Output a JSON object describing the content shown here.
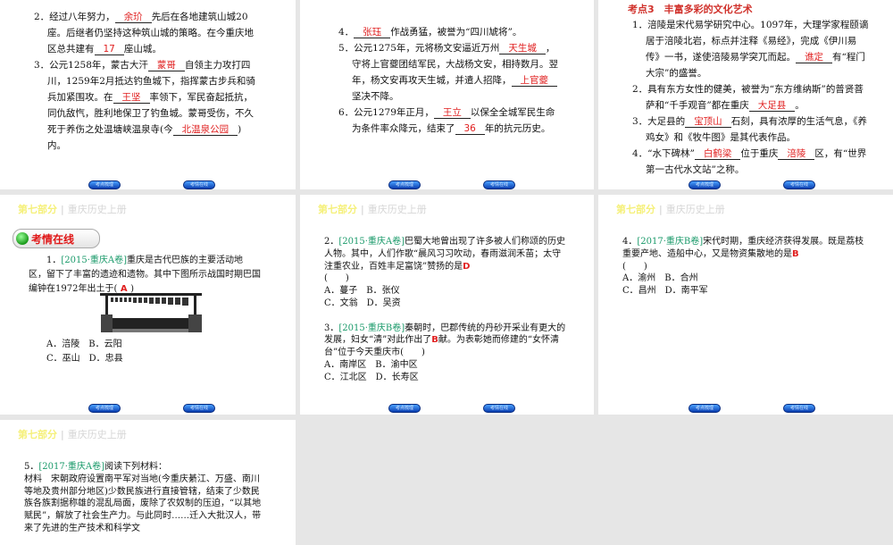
{
  "header": {
    "part": "第七部分",
    "sep": "|",
    "book": "重庆历史上册"
  },
  "nav": {
    "review": "考点梳理",
    "online": "考情在线"
  },
  "section_title": "考情在线",
  "topic3": "考点3　丰富多彩的文化艺术",
  "slides": {
    "s1": [
      [
        {
          "t": "2．经过八年努力，"
        },
        {
          "f": "余玠"
        },
        {
          "t": "先后在各地建筑山城20座。后继者仍坚持这种筑山城的策略。在今重庆地区总共建有"
        },
        {
          "f": "17"
        },
        {
          "t": "座山城。"
        }
      ],
      [
        {
          "t": "3．公元1258年，蒙古大汗"
        },
        {
          "f": "蒙哥"
        },
        {
          "t": "自领主力攻打四川，1259年2月抵达钓鱼城下，指挥蒙古步兵和骑兵加紧围攻。在"
        },
        {
          "f": "王坚"
        },
        {
          "t": "率领下，军民奋起抵抗，同仇敌忾，胜利地保卫了钓鱼城。蒙哥受伤，不久死于养伤之处温塘峡温泉寺(今"
        },
        {
          "f": "北温泉公园"
        },
        {
          "t": ")内。"
        }
      ]
    ],
    "s2": [
      [
        {
          "t": "4．"
        },
        {
          "f": "张珏"
        },
        {
          "t": "作战勇猛，被誉为“四川虓将”。"
        }
      ],
      [
        {
          "t": "5．公元1275年，元将杨文安逼近万州"
        },
        {
          "f": "天生城"
        },
        {
          "t": "，守将上官夔团结军民，大战杨文安，相持数月。翌年，杨文安再攻天生城，并遣人招降，"
        },
        {
          "f": "上官夔"
        },
        {
          "t": "坚决不降。"
        }
      ],
      [
        {
          "t": "6．公元1279年正月，"
        },
        {
          "f": "王立"
        },
        {
          "t": "以保全全城军民生命为条件率众降元，结束了"
        },
        {
          "f": "36"
        },
        {
          "t": "年的抗元历史。"
        }
      ]
    ],
    "s3": [
      [
        {
          "t": "1．涪陵是宋代易学研究中心。1097年，大理学家程颐谪居于涪陵北岩，标点并注释《易经》，完成《伊川易传》一书，遂使涪陵易学突兀而起。"
        },
        {
          "f": "谯定"
        },
        {
          "t": "有“程门大宗”的盛誉。"
        }
      ],
      [
        {
          "t": "2．具有东方女性的健美，被誉为“东方维纳斯”的普贤菩萨和“千手观音”都在重庆"
        },
        {
          "f": "大足县"
        },
        {
          "t": "。"
        }
      ],
      [
        {
          "t": "3．大足县的"
        },
        {
          "f": "宝顶山"
        },
        {
          "t": "石刻，具有浓厚的生活气息，《养鸡女》和《牧牛图》是其代表作品。"
        }
      ],
      [
        {
          "t": "4．“水下碑林”"
        },
        {
          "f": "白鹤梁"
        },
        {
          "t": "位于重庆"
        },
        {
          "f": "涪陵"
        },
        {
          "t": "区，有“世界第一古代水文站”之称。"
        }
      ]
    ],
    "s4": [
      [
        {
          "t": "　　1．"
        },
        {
          "s": "[2015·重庆A卷]"
        },
        {
          "t": "重庆是古代巴族的主要活动地区，留下了丰富的遗迹和遗物。其中下图所示战国时期巴国编钟在1972年出土于("
        },
        {
          "a": " A "
        },
        {
          "t": ")"
        }
      ]
    ],
    "s4opts": [
      [
        {
          "t": "　　A．涪陵　B．云阳"
        }
      ],
      [
        {
          "t": "　　C．巫山　D．忠县"
        }
      ]
    ],
    "s5": [
      [
        {
          "t": "2．"
        },
        {
          "s": "[2015·重庆A卷]"
        },
        {
          "t": "巴蜀大地曾出现了许多被人们称颂的历史人物。其中，人们作歌“晨风习习吹动，春雨滋润禾苗；太守注重农业，百姓丰足富饶”赞扬的是"
        },
        {
          "a": "D"
        }
      ],
      [
        {
          "t": "(　　)"
        }
      ],
      [
        {
          "t": "A．蔓子　B．张仪"
        }
      ],
      [
        {
          "t": "C．文翁　D．吴资"
        }
      ],
      [
        {
          "t": "　"
        }
      ],
      [
        {
          "t": "3．"
        },
        {
          "s": "[2015·重庆B卷]"
        },
        {
          "t": "秦朝时，巴郡传统的丹砂开采业有更大的发展，妇女“清”对此作出了"
        },
        {
          "a": "B"
        },
        {
          "t": "献。为表彰她而修建的“女怀清台”位于今天重庆市(　　)"
        }
      ],
      [
        {
          "t": "A．南岸区　B．渝中区"
        }
      ],
      [
        {
          "t": "C．江北区　D．长寿区"
        }
      ]
    ],
    "s6": [
      [
        {
          "t": "4．"
        },
        {
          "s": "[2017·重庆B卷]"
        },
        {
          "t": "宋代时期，重庆经济获得发展。既是荔枝重要产地、造船中心，又是物资集散地的是"
        },
        {
          "a": "B"
        }
      ],
      [
        {
          "t": "(　　)"
        }
      ],
      [
        {
          "t": "A．渝州　B．合州"
        }
      ],
      [
        {
          "t": "C．昌州　D．南平军"
        }
      ]
    ],
    "s7": [
      [
        {
          "t": "5．"
        },
        {
          "s": "[2017·重庆A卷]"
        },
        {
          "t": "阅读下列材料："
        }
      ],
      [
        {
          "t": "材料　宋朝政府设置南平军对当地(今重庆綦江、万盛、南川等地及贵州部分地区)少数民族进行直接管辖，结束了少数民族各族割据称雄的混乱局面，废除了农奴制的压迫，“以其地赋民”，解放了社会生产力。与此同时……迁入大批汉人，带来了先进的生产技术和科学文"
        }
      ]
    ]
  }
}
